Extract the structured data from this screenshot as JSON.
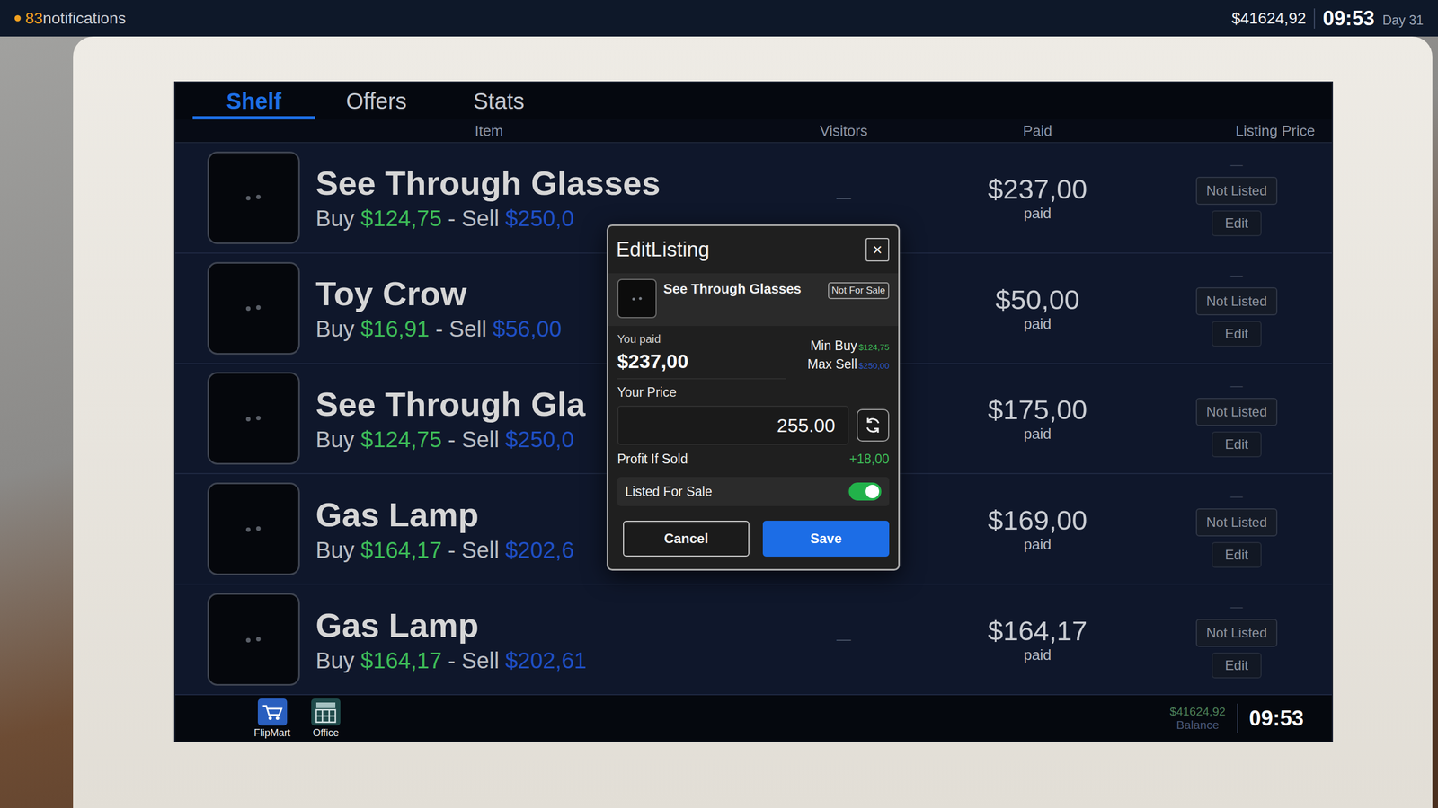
{
  "top_bar": {
    "notification_count": "83",
    "notification_label": "notifications",
    "balance": "$41624,92",
    "time": "09:53",
    "day": "Day 31"
  },
  "tabs": [
    {
      "label": "Shelf",
      "selected": true
    },
    {
      "label": "Offers",
      "selected": false
    },
    {
      "label": "Stats",
      "selected": false
    }
  ],
  "table": {
    "columns": [
      "Item",
      "Visitors",
      "Paid",
      "Listing Price"
    ],
    "rows": [
      {
        "name": "See Through Glasses",
        "buy_label": "Buy",
        "buy": "$124,75",
        "sep": "-",
        "sell_label": "Sell",
        "sell": "$250,0",
        "visitors": "—",
        "paid": "$237,00",
        "paid_label": "paid",
        "listing_mark": "—",
        "status": "Not Listed",
        "action": "Edit"
      },
      {
        "name": "Toy Crow",
        "buy_label": "Buy",
        "buy": "$16,91",
        "sep": "-",
        "sell_label": "Sell",
        "sell": "$56,00",
        "paid": "$50,00",
        "paid_label": "paid",
        "listing_mark": "—",
        "status": "Not Listed",
        "action": "Edit"
      },
      {
        "name": "See Through Gla",
        "buy_label": "Buy",
        "buy": "$124,75",
        "sep": "-",
        "sell_label": "Sell",
        "sell": "$250,0",
        "paid": "$175,00",
        "paid_label": "paid",
        "listing_mark": "—",
        "status": "Not Listed",
        "action": "Edit"
      },
      {
        "name": "Gas Lamp",
        "buy_label": "Buy",
        "buy": "$164,17",
        "sep": "-",
        "sell_label": "Sell",
        "sell": "$202,6",
        "paid": "$169,00",
        "paid_label": "paid",
        "listing_mark": "—",
        "status": "Not Listed",
        "action": "Edit"
      },
      {
        "name": "Gas Lamp",
        "buy_label": "Buy",
        "buy": "$164,17",
        "sep": "-",
        "sell_label": "Sell",
        "sell": "$202,61",
        "visitors": "—",
        "paid": "$164,17",
        "paid_label": "paid",
        "listing_mark": "—",
        "status": "Not Listed",
        "action": "Edit"
      }
    ]
  },
  "taskbar": {
    "apps": [
      {
        "label": "FlipMart"
      },
      {
        "label": "Office"
      }
    ],
    "balance": "$41624,92",
    "balance_label": "Balance",
    "time": "09:53"
  },
  "dialog": {
    "title": "EditListing",
    "close": "×",
    "item_name": "See Through Glasses",
    "badge": "Not For Sale",
    "paid_label": "You paid",
    "paid": "$237,00",
    "min_buy_label": "Min Buy",
    "min_buy": "$124,75",
    "max_sell_label": "Max Sell",
    "max_sell": "$250,00",
    "price_label": "Your Price",
    "price": "255.00",
    "profit_label": "Profit If Sold",
    "profit": "+18,00",
    "listed_label": "Listed For Sale",
    "listed": true,
    "cancel": "Cancel",
    "save": "Save"
  }
}
